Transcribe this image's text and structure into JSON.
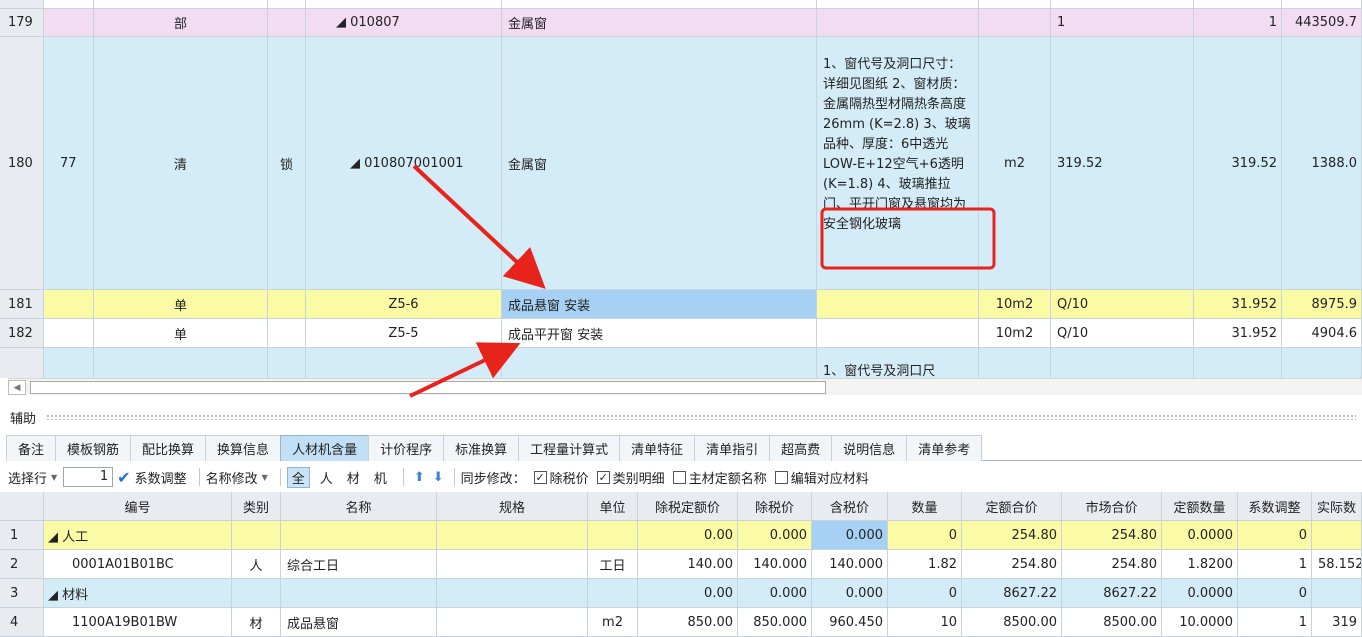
{
  "top_grid": {
    "rows": [
      {
        "row": "179",
        "seq": "",
        "type": "部",
        "lock": "",
        "code": "◢ 010807",
        "name": "金属窗",
        "features": "",
        "unit": "",
        "expr": "1",
        "qty": "1",
        "price": "443509.7"
      },
      {
        "row": "180",
        "seq": "77",
        "type": "清",
        "lock": "锁",
        "code": "◢ 010807001001",
        "name": "金属窗",
        "features": "1、窗代号及洞口尺寸：详细见图纸 2、窗材质：金属隔热型材隔热条高度26mm (K=2.8) 3、玻璃品种、厚度：6中透光LOW-E+12空气+6透明(K=1.8) 4、玻璃推拉门、平开门窗及悬窗均为安全钢化玻璃",
        "unit": "m2",
        "expr": "319.52",
        "qty": "319.52",
        "price": "1388.0"
      },
      {
        "row": "181",
        "seq": "",
        "type": "单",
        "lock": "",
        "code": "Z5-6",
        "name": "成品悬窗 安装",
        "features": "",
        "unit": "10m2",
        "expr": "Q/10",
        "qty": "31.952",
        "price": "8975.9"
      },
      {
        "row": "182",
        "seq": "",
        "type": "单",
        "lock": "",
        "code": "Z5-5",
        "name": "成品平开窗 安装",
        "features": "",
        "unit": "10m2",
        "expr": "Q/10",
        "qty": "31.952",
        "price": "4904.6"
      },
      {
        "row": "",
        "seq": "",
        "type": "",
        "lock": "",
        "code": "",
        "name": "",
        "features": "1、窗代号及洞口尺",
        "unit": "",
        "expr": "",
        "qty": "",
        "price": ""
      }
    ]
  },
  "aux": {
    "title": "辅助",
    "tabs": [
      "备注",
      "模板钢筋",
      "配比换算",
      "换算信息",
      "人材机含量",
      "计价程序",
      "标准换算",
      "工程量计算式",
      "清单特征",
      "清单指引",
      "超高费",
      "说明信息",
      "清单参考"
    ],
    "active_tab": "人材机含量"
  },
  "toolbar": {
    "select_row": "选择行",
    "select_value": "1",
    "coef_adjust": "系数调整",
    "name_modify": "名称修改",
    "filter_all": "全",
    "filter_labor": "人",
    "filter_material": "材",
    "filter_machine": "机",
    "sync_modify": "同步修改：",
    "cb_tax_price": "除税价",
    "cb_category_detail": "类别明细",
    "cb_main_material": "主材定额名称",
    "cb_edit_material": "编辑对应材料"
  },
  "bottom_grid": {
    "headers": [
      "",
      "编号",
      "类别",
      "名称",
      "规格",
      "单位",
      "除税定额价",
      "除税价",
      "含税价",
      "数量",
      "定额合价",
      "市场合价",
      "定额数量",
      "系数调整",
      "实际数"
    ],
    "rows": [
      {
        "num": "1",
        "code": "◢ 人工",
        "cat": "",
        "name": "",
        "spec": "",
        "unit": "",
        "base": "0.00",
        "notax": "0.000",
        "tax": "0.000",
        "qty": "0",
        "total": "254.80",
        "market": "254.80",
        "bqty": "0.0000",
        "coef": "0",
        "actual": ""
      },
      {
        "num": "2",
        "code": "0001A01B01BC",
        "cat": "人",
        "name": "综合工日",
        "spec": "",
        "unit": "工日",
        "base": "140.00",
        "notax": "140.000",
        "tax": "140.000",
        "qty": "1.82",
        "total": "254.80",
        "market": "254.80",
        "bqty": "1.8200",
        "coef": "1",
        "actual": "58.152"
      },
      {
        "num": "3",
        "code": "◢ 材料",
        "cat": "",
        "name": "",
        "spec": "",
        "unit": "",
        "base": "0.00",
        "notax": "0.000",
        "tax": "0.000",
        "qty": "0",
        "total": "8627.22",
        "market": "8627.22",
        "bqty": "0.0000",
        "coef": "0",
        "actual": ""
      },
      {
        "num": "4",
        "code": "1100A19B01BW",
        "cat": "材",
        "name": "成品悬窗",
        "spec": "",
        "unit": "m2",
        "base": "850.00",
        "notax": "850.000",
        "tax": "960.450",
        "qty": "10",
        "total": "8500.00",
        "market": "8500.00",
        "bqty": "10.0000",
        "coef": "1",
        "actual": "319"
      }
    ]
  },
  "colors": {
    "pink": "#f1dcf1",
    "blue": "#d4ecf7",
    "yellow": "#fbfba6",
    "selected": "#a6d1f5",
    "annotation_red": "#e8231c"
  }
}
